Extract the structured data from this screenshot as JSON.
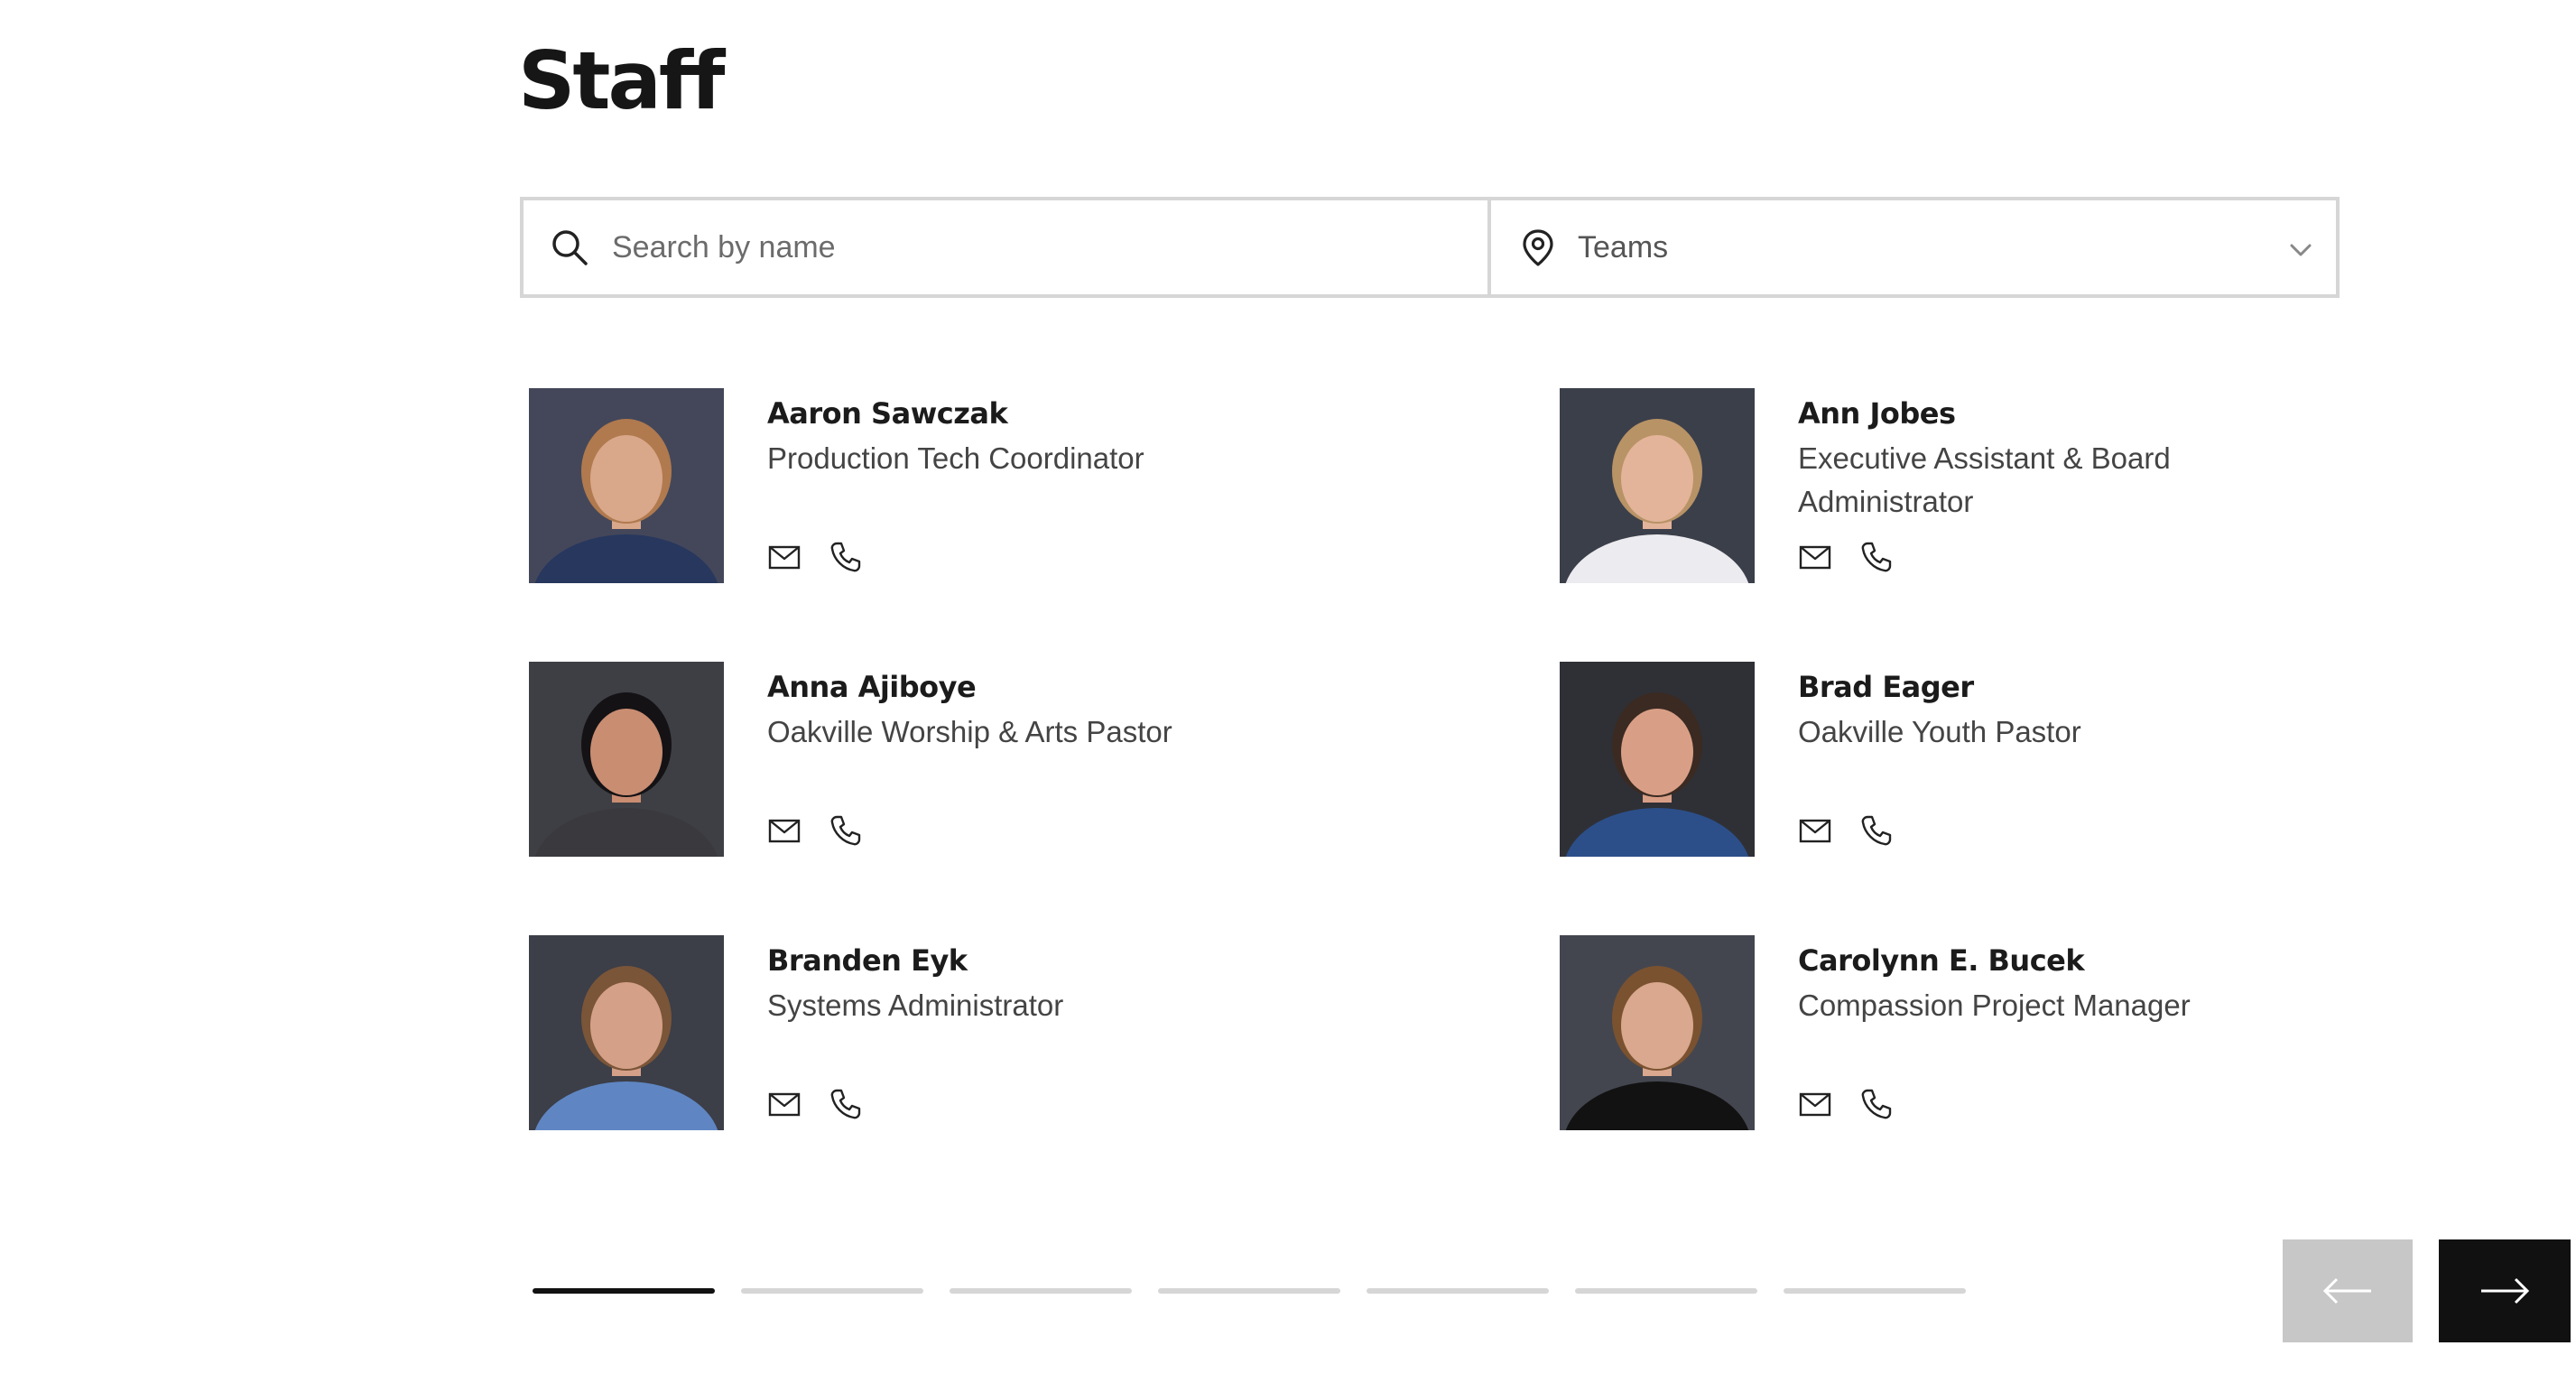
{
  "page": {
    "title": "Staff"
  },
  "search": {
    "placeholder": "Search by name"
  },
  "teams_filter": {
    "label": "Teams"
  },
  "staff": [
    {
      "name": "Aaron Sawczak",
      "role": "Production Tech Coordinator",
      "photo": {
        "bg": "#44475a",
        "skin": "#d9a78a",
        "hair": "#b07a4e",
        "shirt": "#27375e"
      }
    },
    {
      "name": "Ann Jobes",
      "role": "Executive Assistant & Board Administrator",
      "photo": {
        "bg": "#3b3f4a",
        "skin": "#e3b49a",
        "hair": "#b89366",
        "shirt": "#ecebef"
      }
    },
    {
      "name": "Anna Ajiboye",
      "role": "Oakville Worship & Arts Pastor",
      "photo": {
        "bg": "#3e3f44",
        "skin": "#c98d72",
        "hair": "#141214",
        "shirt": "#3a3a3e"
      }
    },
    {
      "name": "Brad Eager",
      "role": "Oakville Youth Pastor",
      "photo": {
        "bg": "#2f3036",
        "skin": "#d99f86",
        "hair": "#3a2a22",
        "shirt": "#2c4f8a"
      }
    },
    {
      "name": "Branden Eyk",
      "role": "Systems Administrator",
      "photo": {
        "bg": "#3c3e48",
        "skin": "#d5a088",
        "hair": "#7a5538",
        "shirt": "#5f86c2"
      }
    },
    {
      "name": "Carolynn E. Bucek",
      "role": "Compassion Project Manager",
      "photo": {
        "bg": "#44464f",
        "skin": "#d9a88e",
        "hair": "#7a5230",
        "shirt": "#121212"
      }
    }
  ],
  "icons": {
    "email": "envelope-icon",
    "phone": "phone-icon",
    "search": "search-icon",
    "location": "location-pin-icon",
    "chevron": "chevron-down-icon"
  },
  "pagination": {
    "pages": 7,
    "current": 1
  },
  "colors": {
    "active_page": "#111111",
    "inactive_page": "#d6d6d6",
    "prev_bg": "#c7c7c7",
    "next_bg": "#111111"
  }
}
